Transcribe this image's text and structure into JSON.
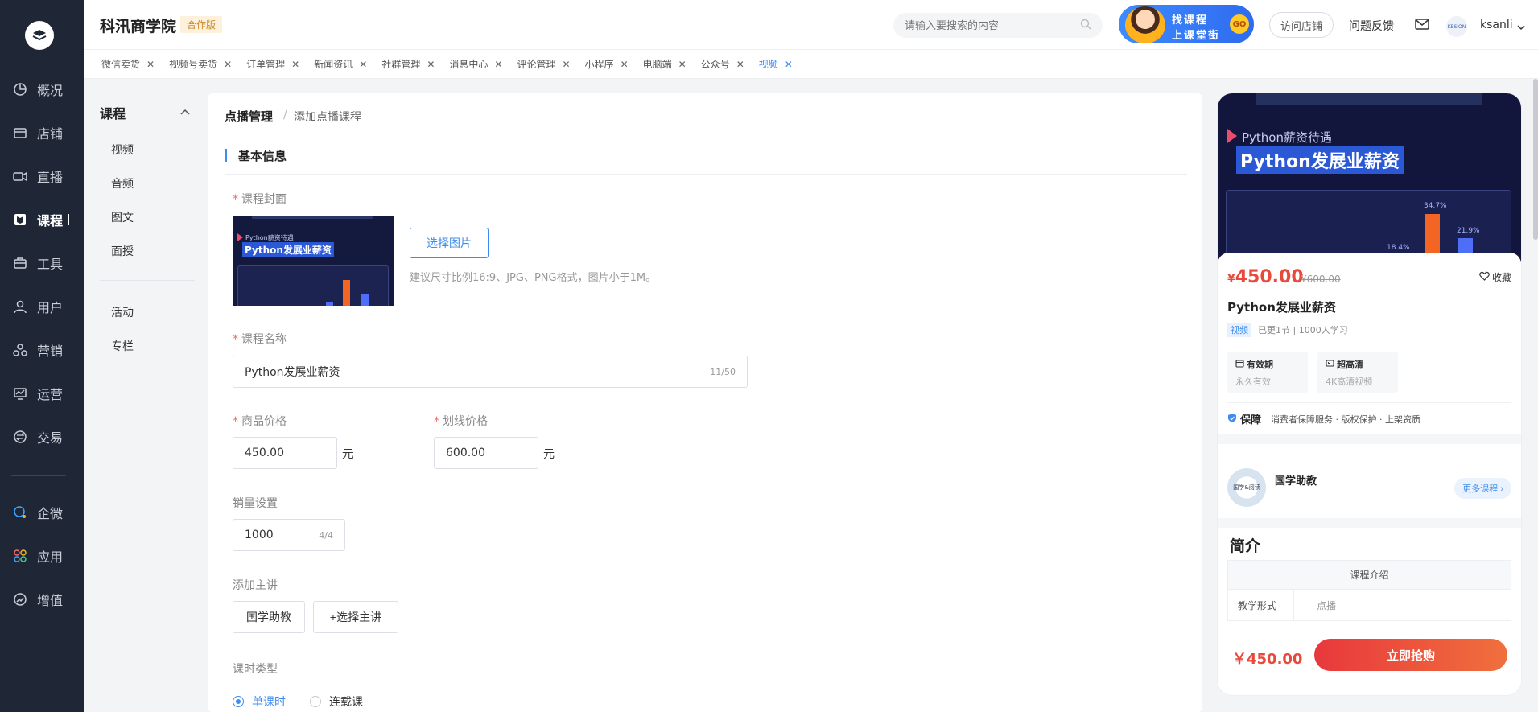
{
  "header": {
    "brand": "科汛商学院",
    "edition": "合作版",
    "search_placeholder": "请输入要搜索的内容",
    "promo_line1": "找课程",
    "promo_line2": "上课堂街",
    "promo_go": "GO",
    "visit_store": "访问店铺",
    "feedback": "问题反馈",
    "avatar_text": "KESION",
    "username": "ksanli"
  },
  "rail": {
    "items": [
      "概况",
      "店铺",
      "直播",
      "课程",
      "工具",
      "用户",
      "营销",
      "运营",
      "交易",
      "企微",
      "应用",
      "增值"
    ],
    "active": "课程"
  },
  "tabs": [
    "微信卖货",
    "视频号卖货",
    "订单管理",
    "新闻资讯",
    "社群管理",
    "消息中心",
    "评论管理",
    "小程序",
    "电脑端",
    "公众号",
    "视频"
  ],
  "active_tab": "视频",
  "submenu": {
    "title": "课程",
    "items": [
      "视频",
      "音频",
      "图文",
      "面授"
    ],
    "items2": [
      "活动",
      "专栏"
    ]
  },
  "breadcrumb": {
    "main": "点播管理",
    "sep": "/",
    "sub": "添加点播课程"
  },
  "section_title": "基本信息",
  "form": {
    "cover_label": "课程封面",
    "cover_s1": "Python薪资待遇",
    "cover_s2": "Python发展业薪资",
    "pick_image": "选择图片",
    "cover_hint": "建议尺寸比例16:9、JPG、PNG格式，图片小于1M。",
    "name_label": "课程名称",
    "name_value": "Python发展业薪资",
    "name_count": "11/50",
    "price_label": "商品价格",
    "price_value": "450.00",
    "oprice_label": "划线价格",
    "oprice_value": "600.00",
    "unit": "元",
    "sales_label": "销量设置",
    "sales_value": "1000",
    "sales_count": "4/4",
    "teacher_label": "添加主讲",
    "teacher_name": "国学助教",
    "teacher_add": "+选择主讲",
    "lesson_type_label": "课时类型",
    "lesson_single": "单课时",
    "lesson_series": "连载课"
  },
  "preview": {
    "hero_s1": "Python薪资待遇",
    "hero_s2": "Python发展业薪资",
    "bar_label1": "34.7%",
    "bar_label2": "21.9%",
    "bar_label3": "18.4%",
    "price_symbol": "¥",
    "price": "450.00",
    "original_price": "¥600.00",
    "fav": "收藏",
    "title": "Python发展业薪资",
    "tag": "视频",
    "meta": "已更1节 | 1000人学习",
    "feat1_title": "有效期",
    "feat1_sub": "永久有效",
    "feat2_title": "超高清",
    "feat2_sub": "4K高清视频",
    "guard_title": "保障",
    "guard_text": "消费者保障服务 · 版权保护 · 上架资质",
    "tutor_avatar": "国学&阅读",
    "tutor_name": "国学助教",
    "more_courses": "更多课程",
    "intro_title": "简介",
    "table_header": "课程介绍",
    "row_key": "教学形式",
    "row_val": "点播",
    "footer_price": "￥450.00",
    "buy": "立即抢购"
  },
  "colors": {
    "accent": "#3e8cf0",
    "price": "#e8493b",
    "rail": "#1f2736"
  }
}
